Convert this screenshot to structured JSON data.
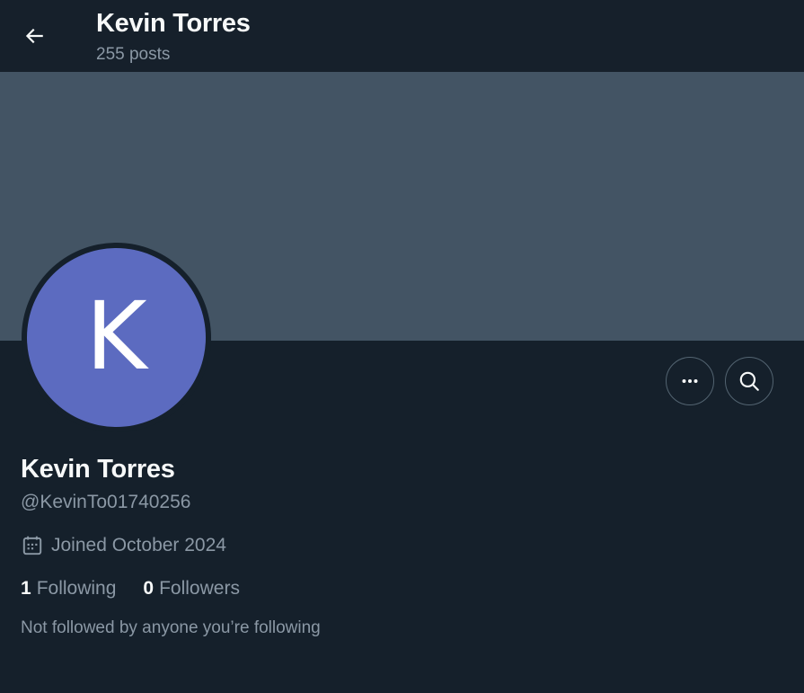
{
  "header": {
    "title": "Kevin Torres",
    "subtitle": "255 posts"
  },
  "profile": {
    "avatar_letter": "K",
    "avatar_color": "#5c6bc0",
    "banner_color": "#435464",
    "display_name": "Kevin Torres",
    "handle": "@KevinTo01740256",
    "joined": "Joined October 2024",
    "following_count": "1",
    "following_label": "Following",
    "followers_count": "0",
    "followers_label": "Followers",
    "mutuals_note": "Not followed by anyone you’re following"
  },
  "icons": {
    "back": "arrow-left-icon",
    "more": "more-horizontal-icon",
    "search": "search-icon",
    "calendar": "calendar-icon"
  }
}
